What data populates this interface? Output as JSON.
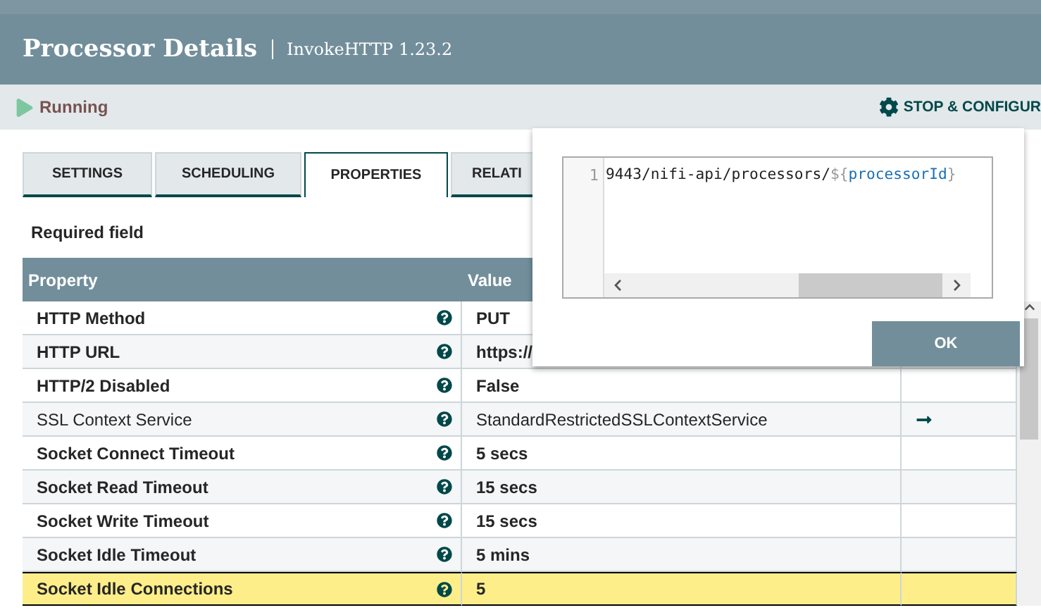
{
  "header": {
    "title": "Processor Details",
    "subtitle": "InvokeHTTP 1.23.2"
  },
  "status": {
    "label": "Running",
    "action": "STOP & CONFIGUR"
  },
  "tabs": [
    {
      "label": "SETTINGS",
      "selected": false
    },
    {
      "label": "SCHEDULING",
      "selected": false
    },
    {
      "label": "PROPERTIES",
      "selected": true
    },
    {
      "label": "RELATI",
      "selected": false
    }
  ],
  "required_note": "Required field",
  "table": {
    "columns": [
      "Property",
      "Value"
    ],
    "rows": [
      {
        "property": "HTTP Method",
        "value": "PUT",
        "required": true,
        "selected": false,
        "service_link": false
      },
      {
        "property": "HTTP URL",
        "value": "https://",
        "required": true,
        "selected": false,
        "service_link": false
      },
      {
        "property": "HTTP/2 Disabled",
        "value": "False",
        "required": true,
        "selected": false,
        "service_link": false
      },
      {
        "property": "SSL Context Service",
        "value": "StandardRestrictedSSLContextService",
        "required": false,
        "selected": false,
        "service_link": true
      },
      {
        "property": "Socket Connect Timeout",
        "value": "5 secs",
        "required": true,
        "selected": false,
        "service_link": false
      },
      {
        "property": "Socket Read Timeout",
        "value": "15 secs",
        "required": true,
        "selected": false,
        "service_link": false
      },
      {
        "property": "Socket Write Timeout",
        "value": "15 secs",
        "required": true,
        "selected": false,
        "service_link": false
      },
      {
        "property": "Socket Idle Timeout",
        "value": "5 mins",
        "required": true,
        "selected": false,
        "service_link": false
      },
      {
        "property": "Socket Idle Connections",
        "value": "5",
        "required": true,
        "selected": true,
        "service_link": false
      }
    ]
  },
  "editor": {
    "line_number": "1",
    "tokens": [
      {
        "text": "9443/nifi-api/processors/",
        "kind": "plain"
      },
      {
        "text": "${",
        "kind": "punct"
      },
      {
        "text": "processorId",
        "kind": "variable"
      },
      {
        "text": "}",
        "kind": "punct"
      }
    ],
    "button": "OK"
  }
}
